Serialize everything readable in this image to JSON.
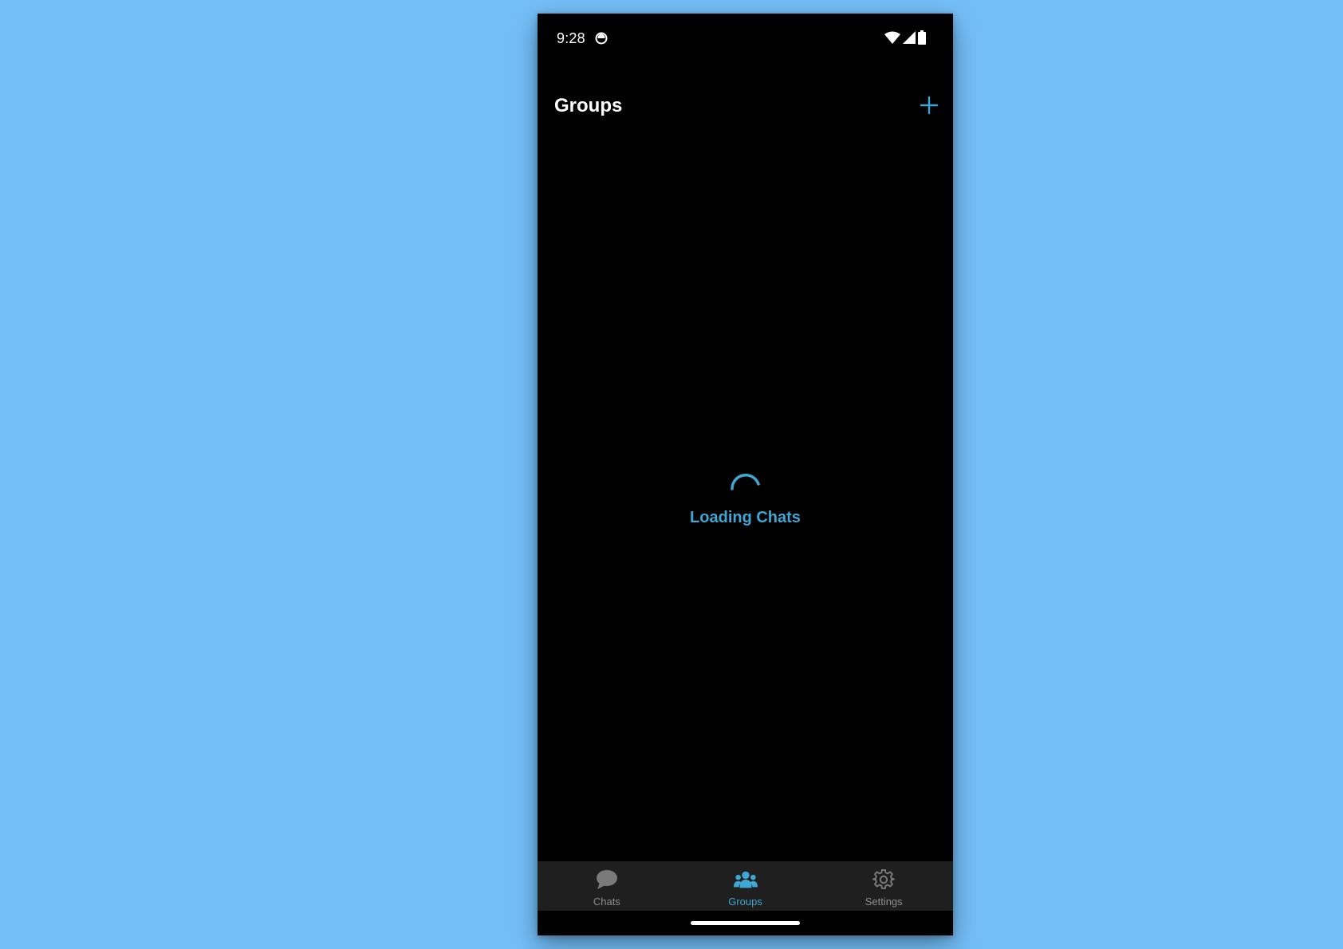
{
  "status_bar": {
    "time": "9:28",
    "notification_icon": "app-notification-icon",
    "icons": [
      "wifi-icon",
      "cell-signal-icon",
      "battery-icon"
    ]
  },
  "header": {
    "title": "Groups",
    "add_icon": "plus-icon"
  },
  "content": {
    "loading_text": "Loading Chats"
  },
  "tabs": [
    {
      "label": "Chats",
      "icon": "chat-bubble-icon",
      "active": false
    },
    {
      "label": "Groups",
      "icon": "people-icon",
      "active": true
    },
    {
      "label": "Settings",
      "icon": "gear-icon",
      "active": false
    }
  ],
  "colors": {
    "accent": "#3fa7d3",
    "background": "#000000",
    "tab_bar": "#1f1f1f",
    "inactive_tab": "#8e8e8e",
    "page_background": "#74bef8"
  }
}
